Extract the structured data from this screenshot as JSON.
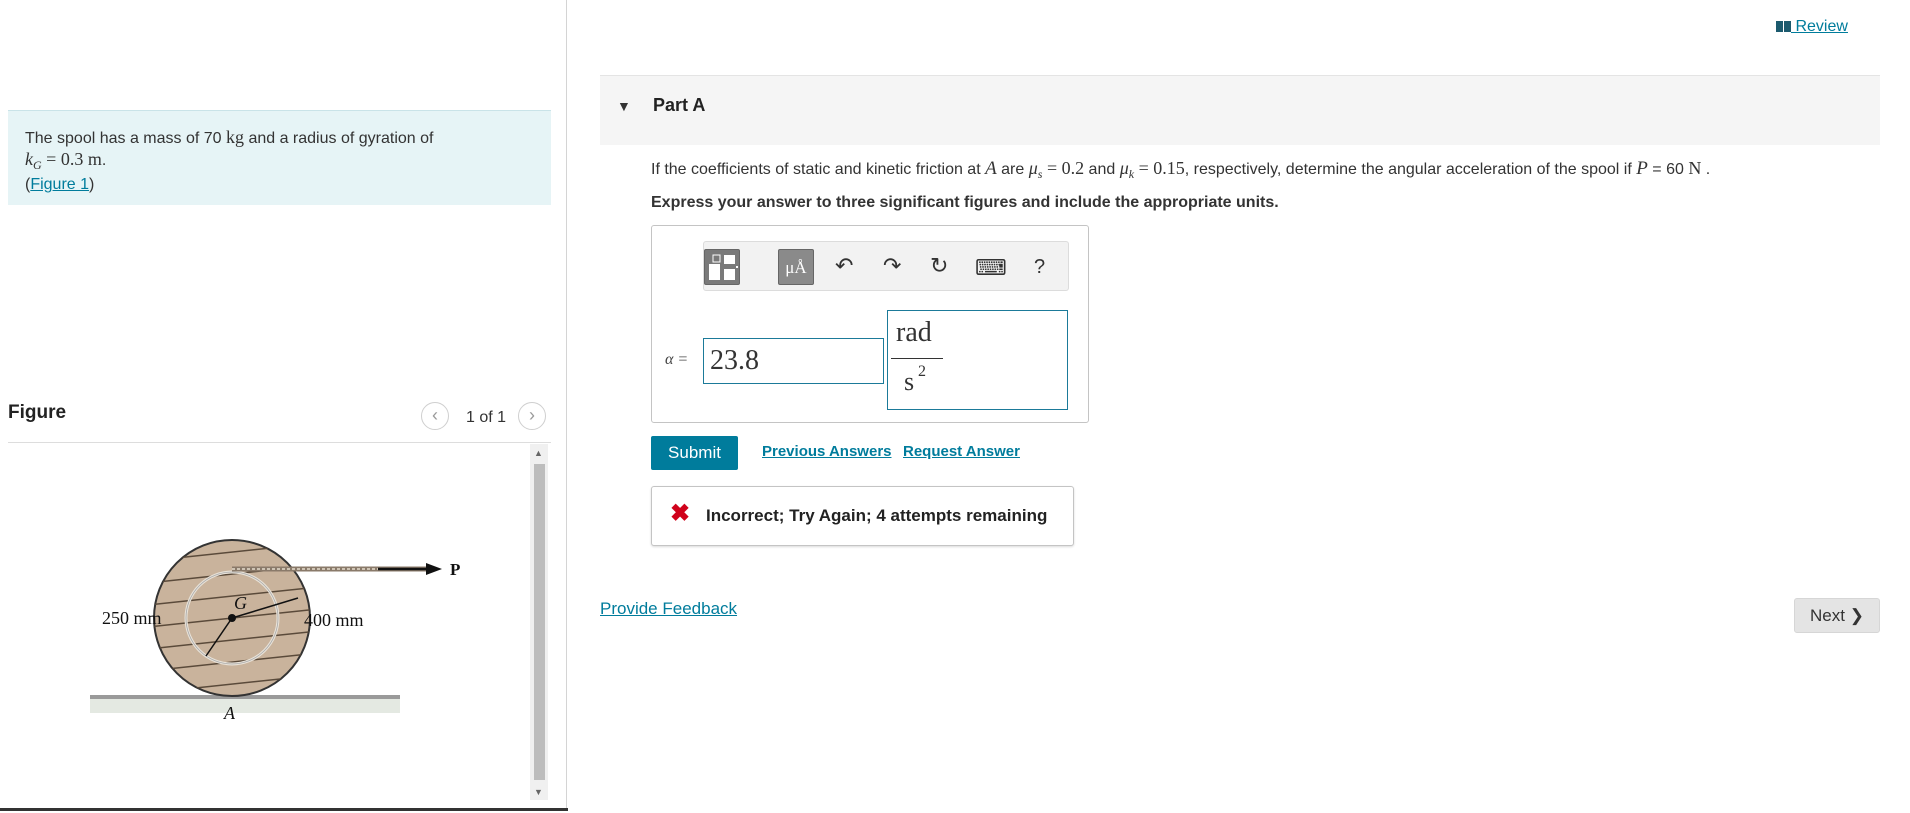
{
  "header": {
    "review_label": " Review"
  },
  "problem": {
    "line1_text": "The spool has a mass of 70 ",
    "line1_unit": "kg",
    "line1_end": " and a radius of gyration of",
    "k_symbol": "k",
    "k_sub": "G",
    "k_value": " = 0.3 m",
    "figure_link": "Figure 1"
  },
  "figure_panel": {
    "title": "Figure",
    "counter": "1 of 1",
    "labels": {
      "inner": "250 mm",
      "outer": "400 mm",
      "center": "G",
      "contact": "A",
      "force": "P"
    }
  },
  "part": {
    "title": "Part A"
  },
  "question": {
    "t1": "If the coefficients of static and kinetic friction at ",
    "A": "A",
    "t2": " are ",
    "mu": "μ",
    "s": "s",
    "eq1": " = 0.2",
    "t3": " and ",
    "k": "k",
    "eq2": " = 0.15",
    "t4": ", respectively, determine the angular acceleration of the spool if ",
    "P": "P",
    "t5": " = 60 ",
    "N": "N",
    "t6": " ."
  },
  "instruction": "Express your answer to three significant figures and include the appropriate units.",
  "answer": {
    "variable_label": "α =",
    "value": "23.8",
    "unit_numerator": "rad",
    "unit_denominator": "s",
    "unit_exponent": "2"
  },
  "toolbar": {
    "units_button_label": "μÅ",
    "undo_icon": "↶",
    "redo_icon": "↷",
    "reset_icon": "↻",
    "keyboard_icon": "⌨",
    "help_label": "?"
  },
  "actions": {
    "submit_label": "Submit",
    "previous_answers_label": "Previous Answers",
    "request_answer_label": "Request Answer"
  },
  "feedback": {
    "icon": "✖",
    "message": "Incorrect; Try Again; 4 attempts remaining"
  },
  "footer": {
    "provide_feedback_label": "Provide Feedback",
    "next_label": "Next ❯"
  },
  "colors": {
    "accent": "#007c9c",
    "error": "#d0021b",
    "problem_bg": "#e6f4f6"
  }
}
